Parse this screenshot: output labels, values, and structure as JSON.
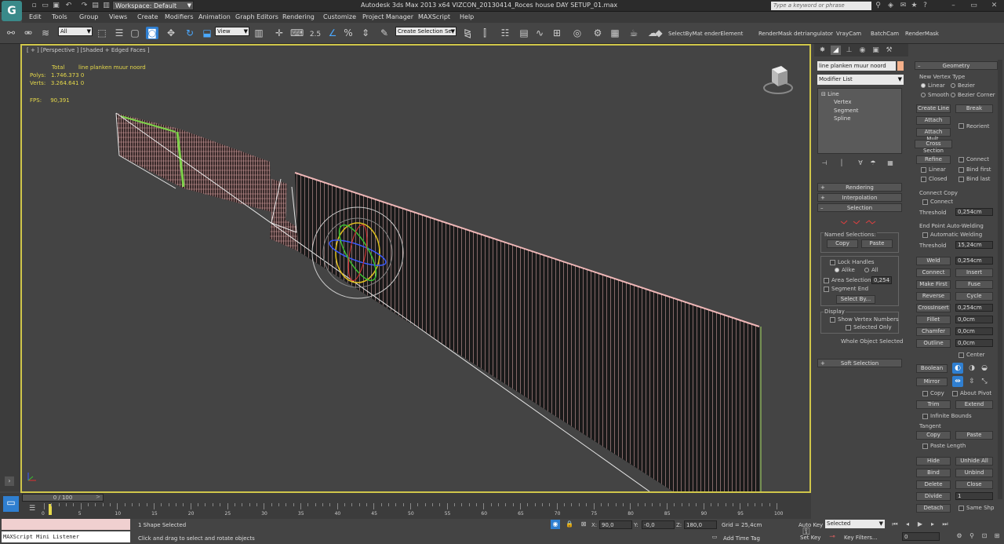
{
  "app": {
    "title": "Autodesk 3ds Max  2013 x64     VIZCON_20130414_Roces house DAY SETUP_01.max",
    "logo": "3ds-max-logo",
    "workspace": "Workspace: Default",
    "search_placeholder": "Type a keyword or phrase"
  },
  "menu": [
    "Edit",
    "Tools",
    "Group",
    "Views",
    "Create",
    "Modifiers",
    "Animation",
    "Graph Editors",
    "Rendering",
    "Customize",
    "Project Manager",
    "MAXScript",
    "Help"
  ],
  "toolbar": {
    "filter_select": "All",
    "ref_coord": "View",
    "snap_value": "2.5",
    "selection_set": "Create Selection Se",
    "scripts": [
      "SelectByMat",
      "enderElement",
      "RenderMask",
      "detriangulator",
      "VrayCam",
      "BatchCam",
      "RenderMask"
    ]
  },
  "viewport": {
    "labels": "[ + ] [Perspective ] [Shaded + Edged Faces ]",
    "stats": {
      "total_label": "Total",
      "selection_name": "line planken muur noord",
      "polys_label": "Polys:",
      "polys_total": "1.746.373",
      "polys_sel": "0",
      "verts_label": "Verts:",
      "verts_total": "3.264.641",
      "verts_sel": "0",
      "fps_label": "FPS:",
      "fps_value": "90,391"
    },
    "mesh_color": "#f0b8b8",
    "accent_green": "#7ed24a",
    "border_color": "#d0c64a"
  },
  "command_panel": {
    "object_name": "line planken muur noord",
    "object_color": "#f5b08a",
    "modifier_list": "Modifier List",
    "stack": [
      "Line",
      "Vertex",
      "Segment",
      "Spline"
    ],
    "rollouts": {
      "rendering": "Rendering",
      "interpolation": "Interpolation",
      "selection": "Selection",
      "soft_selection": "Soft Selection"
    },
    "selection": {
      "named_selections": "Named Selections:",
      "copy": "Copy",
      "paste": "Paste",
      "lock_handles": "Lock Handles",
      "alike": "Alike",
      "all": "All",
      "area_selection": "Area Selection:",
      "area_value": "0,254",
      "segment_end": "Segment End",
      "select_by": "Select By...",
      "display": "Display",
      "show_vertex_numbers": "Show Vertex Numbers",
      "selected_only": "Selected Only",
      "status": "Whole Object Selected"
    },
    "geometry": {
      "title": "Geometry",
      "new_vertex_type": "New Vertex Type",
      "linear": "Linear",
      "bezier": "Bezier",
      "smooth": "Smooth",
      "bezier_corner": "Bezier Corner",
      "create_line": "Create Line",
      "break": "Break",
      "attach": "Attach",
      "reorient": "Reorient",
      "attach_mult": "Attach Mult.",
      "cross_section": "Cross Section",
      "refine": "Refine",
      "connect": "Connect",
      "linear_chk": "Linear",
      "bind_first": "Bind first",
      "closed": "Closed",
      "bind_last": "Bind last",
      "connect_copy": "Connect Copy",
      "connect_chk": "Connect",
      "threshold": "Threshold",
      "threshold_val": "0,254cm",
      "end_point_welding": "End Point Auto-Welding",
      "automatic_welding": "Automatic Welding",
      "threshold2_val": "15,24cm",
      "weld": "Weld",
      "weld_val": "0,254cm",
      "connect_btn": "Connect",
      "insert": "Insert",
      "make_first": "Make First",
      "fuse": "Fuse",
      "reverse": "Reverse",
      "cycle": "Cycle",
      "cross_insert": "CrossInsert",
      "cross_insert_val": "0,254cm",
      "fillet": "Fillet",
      "fillet_val": "0,0cm",
      "chamfer": "Chamfer",
      "chamfer_val": "0,0cm",
      "outline": "Outline",
      "outline_val": "0,0cm",
      "center": "Center",
      "boolean": "Boolean",
      "mirror": "Mirror",
      "copy": "Copy",
      "about_pivot": "About Pivot",
      "trim": "Trim",
      "extend": "Extend",
      "infinite_bounds": "Infinite Bounds",
      "tangent": "Tangent",
      "t_copy": "Copy",
      "t_paste": "Paste",
      "paste_length": "Paste Length",
      "hide": "Hide",
      "unhide_all": "Unhide All",
      "bind": "Bind",
      "unbind": "Unbind",
      "delete": "Delete",
      "close": "Close",
      "divide": "Divide",
      "divide_val": "1",
      "detach": "Detach",
      "same_shp": "Same Shp"
    }
  },
  "timeline": {
    "slider": "0 / 100",
    "ticks": [
      "0",
      "5",
      "10",
      "15",
      "20",
      "25",
      "30",
      "35",
      "40",
      "45",
      "50",
      "55",
      "60",
      "65",
      "70",
      "75",
      "80",
      "85",
      "90",
      "95",
      "100"
    ]
  },
  "status": {
    "maxscript": "MAXScript Mini Listener",
    "selected": "1 Shape Selected",
    "prompt": "Click and drag to select and rotate objects",
    "x_label": "X:",
    "x_val": "90,0",
    "y_label": "Y:",
    "y_val": "-0,0",
    "z_label": "Z:",
    "z_val": "180,0",
    "grid": "Grid = 25,4cm",
    "add_time_tag": "Add Time Tag",
    "auto_key": "Auto Key",
    "set_key": "Set Key",
    "selected_dd": "Selected",
    "key_filters": "Key Filters...",
    "frame": "0"
  }
}
